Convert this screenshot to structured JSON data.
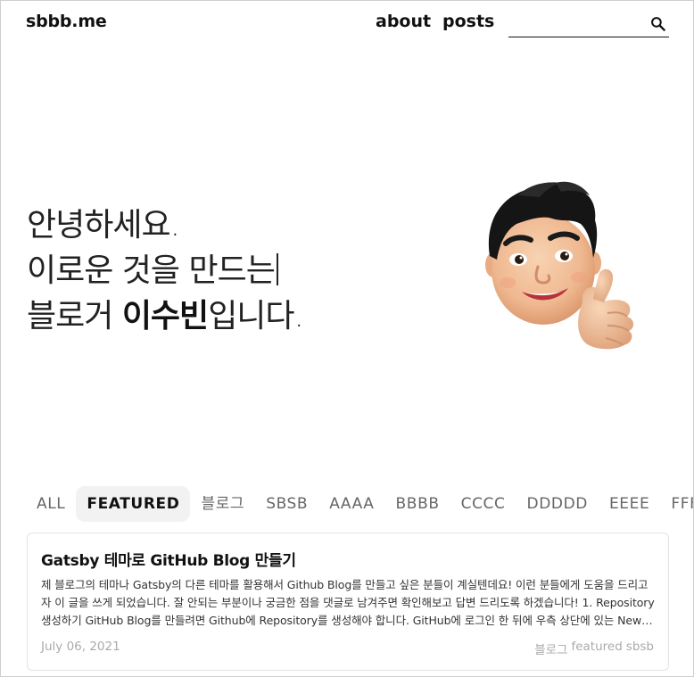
{
  "header": {
    "logo": "sbbb.me",
    "nav": {
      "about": "about",
      "posts": "posts"
    },
    "search": {
      "value": "",
      "placeholder": ""
    }
  },
  "hero": {
    "line1": "안녕하세요.",
    "line2": "이로운 것을 만드는",
    "line3_prefix": "블로거 ",
    "line3_name": "이수빈",
    "line3_suffix": "입니다."
  },
  "avatar": {
    "icon": "memoji-thumbs-up-avatar"
  },
  "tabs": [
    {
      "label": "ALL",
      "active": false
    },
    {
      "label": "FEATURED",
      "active": true
    },
    {
      "label": "블로그",
      "active": false
    },
    {
      "label": "SBSB",
      "active": false
    },
    {
      "label": "AAAA",
      "active": false
    },
    {
      "label": "BBBB",
      "active": false
    },
    {
      "label": "CCCC",
      "active": false
    },
    {
      "label": "DDDDD",
      "active": false
    },
    {
      "label": "EEEE",
      "active": false
    },
    {
      "label": "FFFF",
      "active": false
    }
  ],
  "post": {
    "title": "Gatsby 테마로 GitHub Blog 만들기",
    "excerpt": "제 블로그의 테마나 Gatsby의 다른 테마를 활용해서 Github Blog를 만들고 싶은 분들이 계실텐데요! 이런 분들에게 도움을 드리고자 이 글을 쓰게 되었습니다. 잘 안되는 부분이나 궁금한 점을 댓글로 남겨주면 확인해보고 답변 드리도록 하겠습니다! 1. Repository 생성하기 GitHub Blog를 만들려면 Github에 Repository를 생성해야 합니다. GitHub에 로그인 한 뒤에 우측 상단에 있는 New Repository 버튼을 클릭합니다.",
    "date": "July 06, 2021",
    "tags": [
      "블로그",
      "featured",
      "sbsb"
    ]
  },
  "colors": {
    "text": "#111111",
    "muted": "#666666",
    "meta": "#aaaaaa",
    "active_tab_bg": "#f2f2f2",
    "skin": "#f3c19b",
    "hair": "#1a1a1a"
  }
}
